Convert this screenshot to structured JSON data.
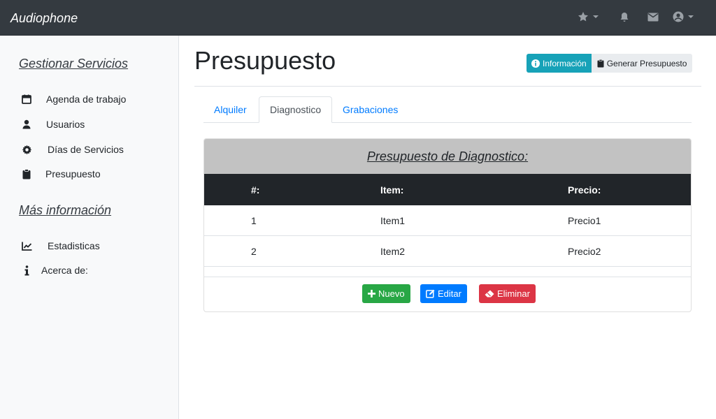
{
  "app": {
    "brand": "Audiophone"
  },
  "sidebar": {
    "section1": "Gestionar Servicios",
    "items1": [
      {
        "label": "Agenda de trabajo",
        "icon": "calendar-icon"
      },
      {
        "label": "Usuarios",
        "icon": "user-icon"
      },
      {
        "label": "Días de Servicios",
        "icon": "gear-icon"
      },
      {
        "label": "Presupuesto",
        "icon": "clipboard-icon"
      }
    ],
    "section2": "Más información",
    "items2": [
      {
        "label": "Estadisticas",
        "icon": "chart-line-icon"
      },
      {
        "label": "Acerca de:",
        "icon": "info-icon"
      }
    ]
  },
  "page": {
    "title": "Presupuesto",
    "info_button": "Información",
    "generate_button": "Generar Presupuesto"
  },
  "tabs": [
    "Alquiler",
    "Diagnostico",
    "Grabaciones"
  ],
  "active_tab": "Diagnostico",
  "card": {
    "title": "Presupuesto de Diagnostico:",
    "columns": [
      "#:",
      "Item:",
      "Precio:"
    ],
    "rows": [
      {
        "num": "1",
        "item": "Item1",
        "price": "Precio1"
      },
      {
        "num": "2",
        "item": "Item2",
        "price": "Precio2"
      }
    ],
    "buttons": {
      "nuevo": "Nuevo",
      "editar": "Editar",
      "eliminar": "Eliminar"
    }
  },
  "colors": {
    "navbar": "#343a40",
    "info": "#17a2b8",
    "success": "#28a745",
    "primary": "#007bff",
    "danger": "#dc3545"
  }
}
